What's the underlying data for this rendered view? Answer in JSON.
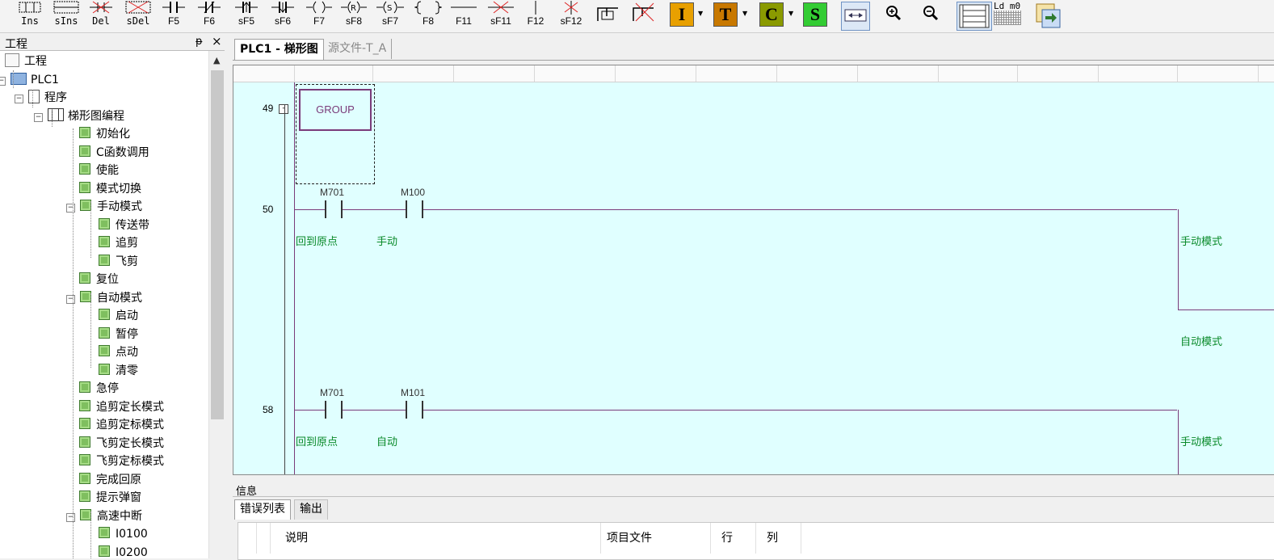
{
  "toolbar": {
    "buttons": [
      {
        "label": "Ins",
        "icon": "insert-rung-icon"
      },
      {
        "label": "sIns",
        "icon": "insert-column-icon"
      },
      {
        "label": "Del",
        "icon": "delete-rung-icon"
      },
      {
        "label": "sDel",
        "icon": "delete-column-icon"
      },
      {
        "label": "F5",
        "icon": "no-contact-icon"
      },
      {
        "label": "F6",
        "icon": "nc-contact-icon"
      },
      {
        "label": "sF5",
        "icon": "rising-contact-icon"
      },
      {
        "label": "sF6",
        "icon": "falling-contact-icon"
      },
      {
        "label": "F7",
        "icon": "coil-icon"
      },
      {
        "label": "sF8",
        "icon": "reset-coil-icon"
      },
      {
        "label": "sF7",
        "icon": "set-coil-icon"
      },
      {
        "label": "F8",
        "icon": "function-block-icon"
      },
      {
        "label": "F11",
        "icon": "horizontal-line-icon"
      },
      {
        "label": "sF11",
        "icon": "delete-line-icon"
      },
      {
        "label": "F12",
        "icon": "vertical-line-icon"
      },
      {
        "label": "sF12",
        "icon": "delete-vertical-line-icon"
      }
    ],
    "color_buttons": [
      {
        "letter": "I",
        "color": "#e8a000"
      },
      {
        "letter": "T",
        "color": "#c87800"
      },
      {
        "letter": "C",
        "color": "#8a9a00"
      },
      {
        "letter": "S",
        "color": "#33cc33"
      }
    ],
    "ld_label": "Ld m0"
  },
  "project": {
    "title": "工程",
    "pin": "ᵽ",
    "close": "×",
    "tree": [
      {
        "label": "工程",
        "level": 0,
        "kind": "proj"
      },
      {
        "label": "PLC1",
        "level": 1,
        "kind": "plc",
        "exp": "-"
      },
      {
        "label": "程序",
        "level": 2,
        "kind": "doc",
        "exp": "-"
      },
      {
        "label": "梯形图编程",
        "level": 3,
        "kind": "lad",
        "exp": "-"
      },
      {
        "label": "初始化",
        "level": 4,
        "kind": "leaf"
      },
      {
        "label": "C函数调用",
        "level": 4,
        "kind": "leaf"
      },
      {
        "label": "使能",
        "level": 4,
        "kind": "leaf"
      },
      {
        "label": "模式切换",
        "level": 4,
        "kind": "leaf"
      },
      {
        "label": "手动模式",
        "level": 4,
        "kind": "leaf",
        "exp": "-"
      },
      {
        "label": "传送带",
        "level": 5,
        "kind": "leaf"
      },
      {
        "label": "追剪",
        "level": 5,
        "kind": "leaf"
      },
      {
        "label": "飞剪",
        "level": 5,
        "kind": "leaf"
      },
      {
        "label": "复位",
        "level": 4,
        "kind": "leaf"
      },
      {
        "label": "自动模式",
        "level": 4,
        "kind": "leaf",
        "exp": "-"
      },
      {
        "label": "启动",
        "level": 5,
        "kind": "leaf"
      },
      {
        "label": "暂停",
        "level": 5,
        "kind": "leaf"
      },
      {
        "label": "点动",
        "level": 5,
        "kind": "leaf"
      },
      {
        "label": "清零",
        "level": 5,
        "kind": "leaf"
      },
      {
        "label": "急停",
        "level": 4,
        "kind": "leaf"
      },
      {
        "label": "追剪定长模式",
        "level": 4,
        "kind": "leaf"
      },
      {
        "label": "追剪定标模式",
        "level": 4,
        "kind": "leaf"
      },
      {
        "label": "飞剪定长模式",
        "level": 4,
        "kind": "leaf"
      },
      {
        "label": "飞剪定标模式",
        "level": 4,
        "kind": "leaf"
      },
      {
        "label": "完成回原",
        "level": 4,
        "kind": "leaf"
      },
      {
        "label": "提示弹窗",
        "level": 4,
        "kind": "leaf"
      },
      {
        "label": "高速中断",
        "level": 4,
        "kind": "leaf",
        "exp": "-"
      },
      {
        "label": "I0100",
        "level": 5,
        "kind": "leaf"
      },
      {
        "label": "I0200",
        "level": 5,
        "kind": "leaf"
      }
    ]
  },
  "editor": {
    "tabs": [
      "PLC1 - 梯形图",
      "源文件-T_A"
    ],
    "group_label": "GROUP",
    "rungs": [
      {
        "step": "49"
      },
      {
        "step": "50",
        "contacts": [
          {
            "addr": "M701",
            "comment": "回到原点"
          },
          {
            "addr": "M100",
            "comment": "手动"
          }
        ],
        "out_comment": "手动模式"
      },
      {
        "step": "",
        "out_comment": "自动模式"
      },
      {
        "step": "58",
        "contacts": [
          {
            "addr": "M701",
            "comment": "回到原点"
          },
          {
            "addr": "M101",
            "comment": "自动"
          }
        ],
        "out_comment": "手动模式"
      }
    ]
  },
  "info": {
    "title": "信息",
    "tabs": [
      "错误列表",
      "输出"
    ],
    "columns": [
      "说明",
      "项目文件",
      "行",
      "列"
    ]
  }
}
